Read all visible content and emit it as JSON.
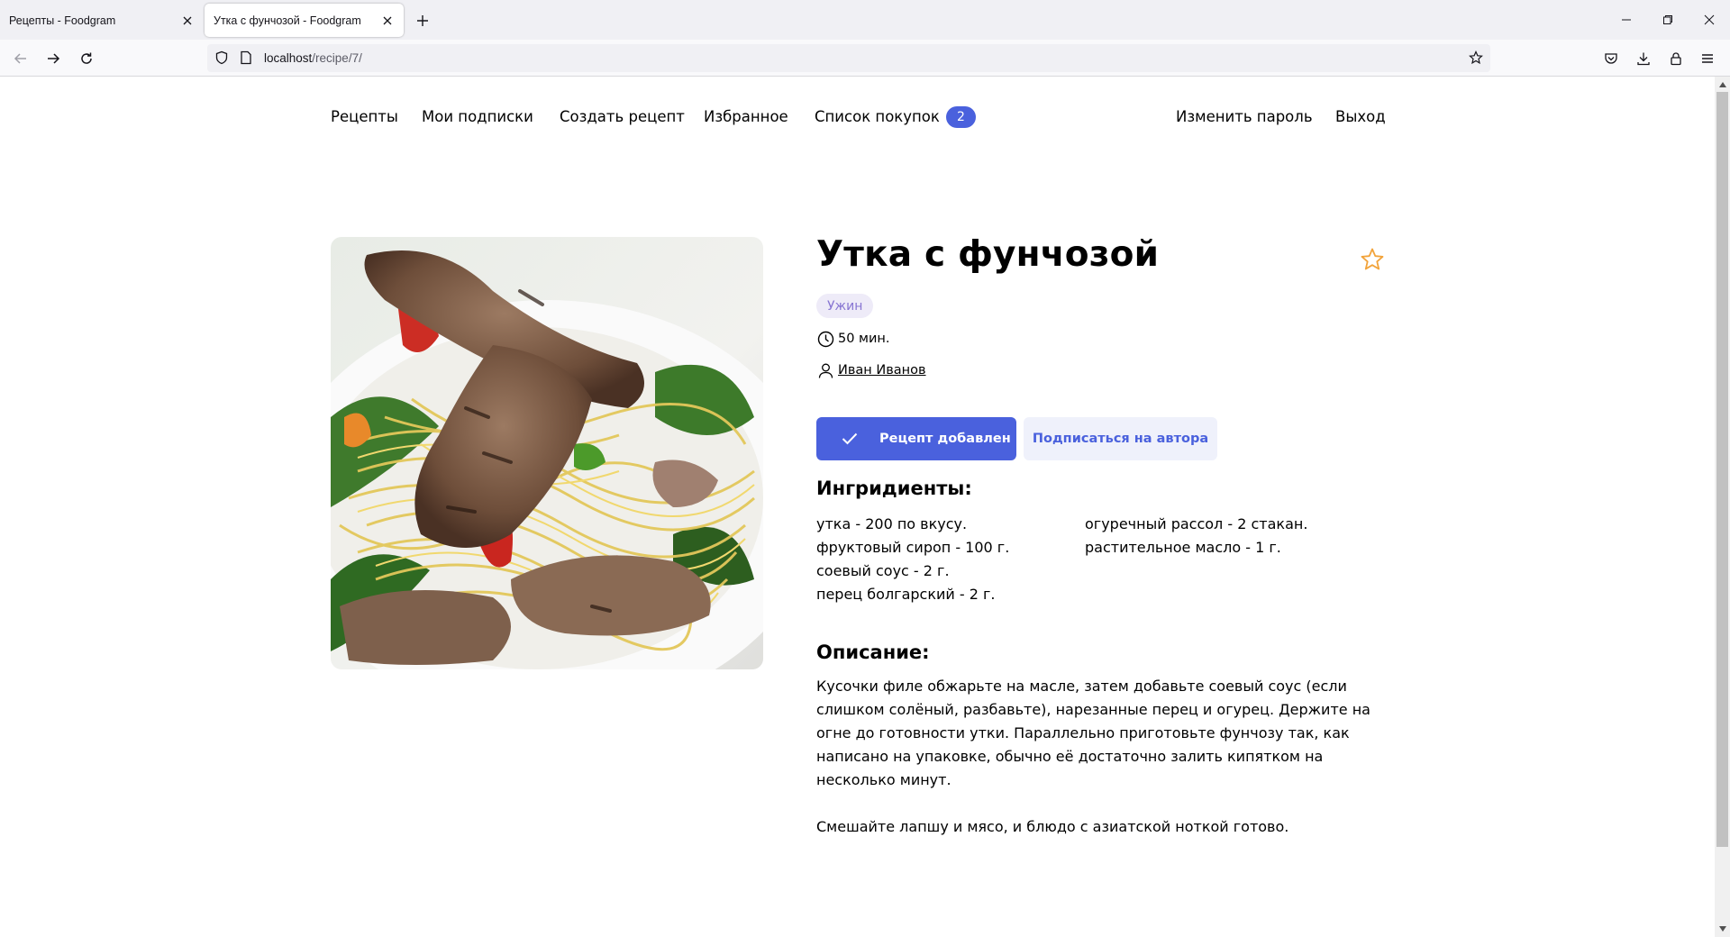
{
  "browser": {
    "tabs": [
      {
        "title": "Рецепты - Foodgram",
        "active": false
      },
      {
        "title": "Утка с фунчозой - Foodgram",
        "active": true
      }
    ],
    "url_host": "localhost",
    "url_path": "/recipe/7/"
  },
  "nav": {
    "recipes": "Рецепты",
    "subscriptions": "Мои подписки",
    "create": "Создать рецепт",
    "favorites": "Избранное",
    "shopping_list": "Список покупок",
    "cart_count": "2",
    "change_password": "Изменить пароль",
    "logout": "Выход"
  },
  "recipe": {
    "title": "Утка с фунчозой",
    "tag": "Ужин",
    "cook_time": "50 мин.",
    "author": "Иван Иванов",
    "added_button": "Рецепт добавлен",
    "subscribe_button": "Подписаться на автора",
    "ingredients_heading": "Ингридиенты:",
    "ingredients_left": [
      "утка - 200 по вкусу.",
      "фруктовый сироп - 100 г.",
      "соевый соус - 2 г.",
      "перец болгарский - 2 г."
    ],
    "ingredients_right": [
      "огуречный рассол - 2 стакан.",
      "растительное масло - 1 г."
    ],
    "description_heading": "Описание:",
    "description_p1": "Кусочки филе обжарьте на масле, затем добавьте соевый соус (если слишком солёный, разбавьте), нарезанные перец и огурец. Держите на огне до готовности утки. Параллельно приготовьте фунчозу так, как написано на упаковке, обычно её достаточно залить кипятком на несколько минут.",
    "description_p2": "Смешайте лапшу и мясо, и блюдо с азиатской ноткой готово."
  },
  "colors": {
    "accent": "#4a61dd",
    "tag_bg": "#eeebf8",
    "tag_text": "#8775d2",
    "star": "#f2a33a"
  },
  "icons": [
    "shield-icon",
    "page-icon",
    "bookmark-star-icon",
    "pocket-icon",
    "download-icon",
    "lock-icon",
    "menu-icon",
    "clock-icon",
    "user-icon",
    "check-icon",
    "star-icon"
  ]
}
